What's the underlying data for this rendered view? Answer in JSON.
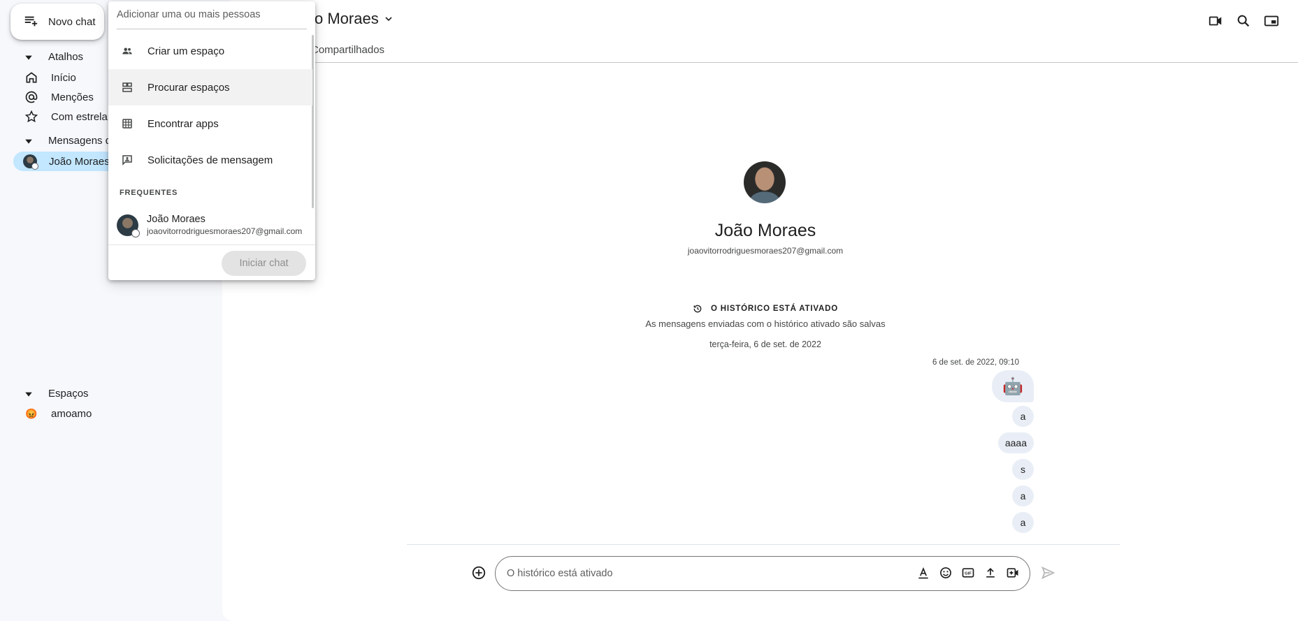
{
  "sidebar": {
    "new_chat_label": "Novo chat",
    "shortcuts_label": "Atalhos",
    "shortcuts": [
      {
        "label": "Início",
        "icon": "home-icon"
      },
      {
        "label": "Menções",
        "icon": "at-icon"
      },
      {
        "label": "Com estrela",
        "icon": "star-icon"
      }
    ],
    "dm_label": "Mensagens d",
    "dm_items": [
      {
        "label": "João Moraes",
        "selected": true
      }
    ],
    "spaces_label": "Espaços",
    "spaces": [
      {
        "label": "amoamo",
        "emoji": "😡"
      }
    ]
  },
  "header": {
    "title": "o Moraes",
    "tab_shared": "Compartilhados"
  },
  "conversation": {
    "profile_name": "João Moraes",
    "profile_email": "joaovitorrodriguesmoraes207@gmail.com",
    "history_title": "O HISTÓRICO ESTÁ ATIVADO",
    "history_sub": "As mensagens enviadas com o histórico ativado são salvas",
    "date_separator": "terça-feira, 6 de set. de 2022",
    "message_time": "6 de set. de 2022, 09:10",
    "messages": [
      "🤖",
      "a",
      "aaaa",
      "s",
      "a",
      "a"
    ]
  },
  "composer": {
    "placeholder": "O histórico está ativado"
  },
  "dropdown": {
    "search_placeholder": "Adicionar uma ou mais pessoas",
    "items": [
      {
        "label": "Criar um espaço",
        "icon": "group-add-icon"
      },
      {
        "label": "Procurar espaços",
        "icon": "browse-spaces-icon"
      },
      {
        "label": "Encontrar apps",
        "icon": "apps-grid-icon"
      },
      {
        "label": "Solicitações de mensagem",
        "icon": "message-request-icon"
      }
    ],
    "frequent_label": "FREQUENTES",
    "frequent": [
      {
        "name": "João Moraes",
        "email": "joaovitorrodriguesmoraes207@gmail.com"
      }
    ],
    "start_button": "Iniciar chat"
  },
  "colors": {
    "selected_bg": "#c2e7ff",
    "bubble_bg": "#e9eef6",
    "page_bg": "#f6f8fc"
  }
}
